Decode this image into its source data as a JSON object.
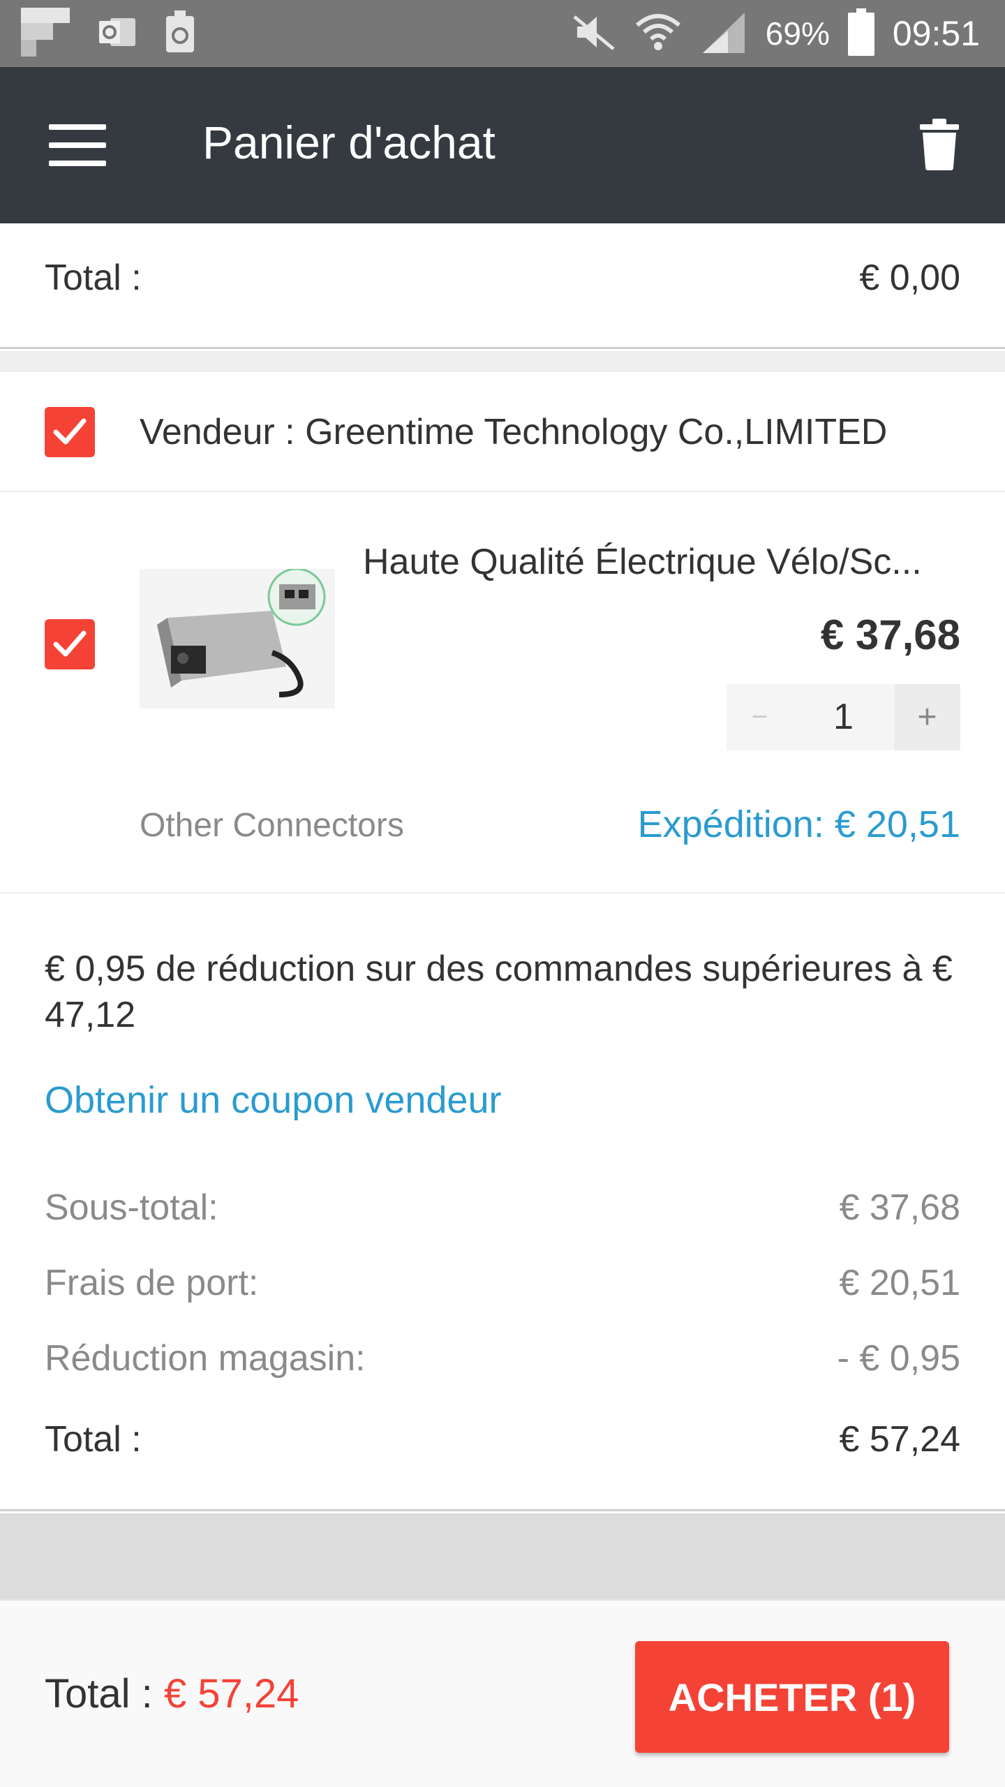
{
  "status_bar": {
    "battery_percent": "69%",
    "time": "09:51",
    "icons": [
      "flipboard-icon",
      "outlook-icon",
      "recycle-icon",
      "mute-icon",
      "wifi-icon",
      "signal-icon",
      "battery-icon"
    ]
  },
  "app_bar": {
    "title": "Panier d'achat",
    "menu_icon": "hamburger-menu-icon",
    "delete_icon": "trash-icon"
  },
  "cart_total": {
    "label": "Total :",
    "value": "€ 0,00"
  },
  "seller": {
    "checked": true,
    "label": "Vendeur :  Greentime Technology Co.,LIMITED"
  },
  "product": {
    "checked": true,
    "name": "Haute Qualité Électrique Vélo/Sc...",
    "price": "€ 37,68",
    "quantity": "1",
    "minus_label": "−",
    "plus_label": "+",
    "variant": "Other Connectors",
    "shipping": "Expédition: € 20,51"
  },
  "store": {
    "discount_notice": "€ 0,95 de réduction sur des commandes supérieures à € 47,12",
    "coupon_link": "Obtenir un coupon vendeur",
    "rows": [
      {
        "label": "Sous-total:",
        "value": "€ 37,68"
      },
      {
        "label": "Frais de port:",
        "value": "€ 20,51"
      },
      {
        "label": "Réduction magasin:",
        "value": "- € 0,95"
      }
    ],
    "total_label": "Total :",
    "total_value": "€ 57,24"
  },
  "bottom_bar": {
    "total_label": "Total : ",
    "total_value": "€ 57,24",
    "buy_label": "ACHETER (1)"
  },
  "colors": {
    "accent_red": "#f44336",
    "link_blue": "#2a9bd0",
    "app_bar": "#353a40",
    "status_bar": "#777777"
  }
}
